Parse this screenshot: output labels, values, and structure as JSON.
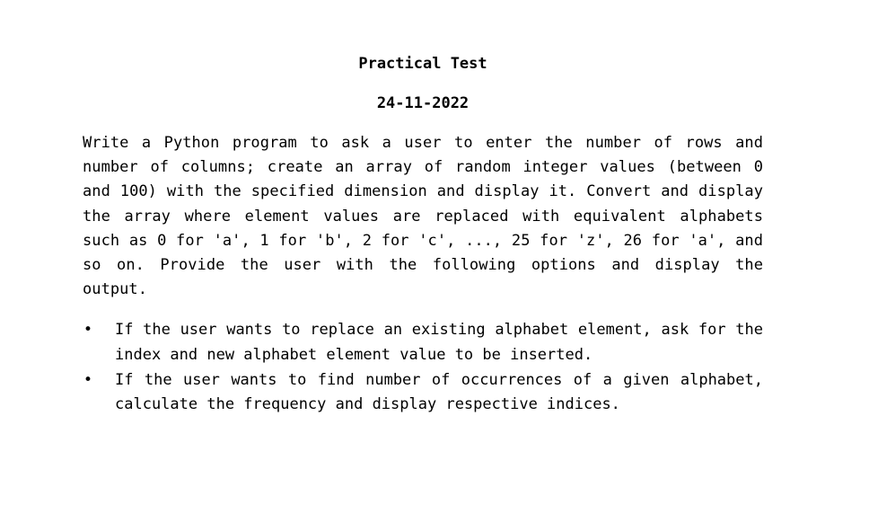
{
  "document": {
    "title": "Practical Test",
    "date": "24-11-2022",
    "intro": "Write a Python program to ask a user to enter the number of rows and number of columns; create an array of random integer values (between 0 and 100) with the specified dimension and display it. Convert and display the array where element values are replaced with equivalent alphabets such as 0 for 'a', 1 for 'b', 2 for 'c', ..., 25 for 'z', 26 for 'a', and so on. Provide the user with the following options and display the output.",
    "bullet_glyph": "•",
    "bullets": [
      "If the user wants to replace an existing alphabet element, ask for the index and new alphabet element value to be inserted.",
      "If the user wants to find number of occurrences of a given alphabet, calculate the frequency and display respective indices."
    ]
  }
}
